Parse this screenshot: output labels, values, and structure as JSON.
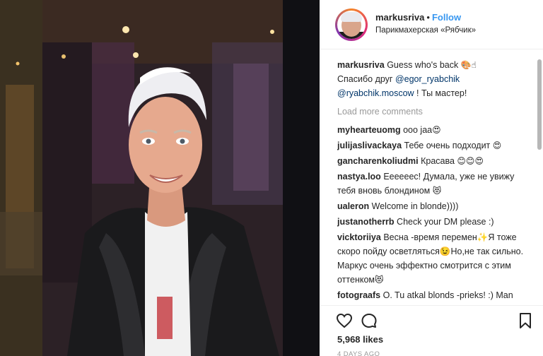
{
  "post": {
    "username": "markusriva",
    "separator": "•",
    "follow_label": "Follow",
    "location": "Парикмахерская «Рябчик»",
    "caption": {
      "user": "markusriva",
      "text_a": "Guess who's back",
      "emoji_a": "🎨☝",
      "text_b": "Спасибо друг",
      "mention_1": "@egor_ryabchik",
      "mention_2": "@ryabchik.moscow",
      "text_c": "! Ты мастер!"
    },
    "load_more_label": "Load more comments",
    "comments": [
      {
        "user": "myhearteuomg",
        "text": "ooo jaa",
        "emoji": "😍"
      },
      {
        "user": "julijaslivackaya",
        "text": "Тебе очень подходит",
        "emoji": "😍"
      },
      {
        "user": "gancharenkoliudmi",
        "text": "Красава",
        "emoji": "😊😊😍"
      },
      {
        "user": "nastya.loo",
        "text": "Ееееееc! Думала, уже не увижу тебя вновь блондином",
        "emoji": "😻"
      },
      {
        "user": "ualeron",
        "text": "Welcome in blonde))))",
        "emoji": ""
      },
      {
        "user": "justanotherrb",
        "text": "Check your DM please :)",
        "emoji": ""
      },
      {
        "user": "vicktoriiya",
        "text": "Весна -время перемен✨Я тоже скоро пойду осветляться😉Но,не так сильно. Маркус очень эффектно смотрится с этим оттенком",
        "emoji": "😻"
      },
      {
        "user": "fotograafs",
        "text": "O. Tu atkal blonds -prieks! :) Man liekas, tā Tev labāk piestāv! :)",
        "emoji": ""
      }
    ],
    "likes_label": "5,968 likes",
    "time_label": "4 DAYS AGO",
    "icons": {
      "like": "heart-icon",
      "comment": "comment-icon",
      "save": "bookmark-icon"
    },
    "colors": {
      "follow": "#3897f0",
      "mention": "#003569",
      "muted": "#999999"
    }
  }
}
